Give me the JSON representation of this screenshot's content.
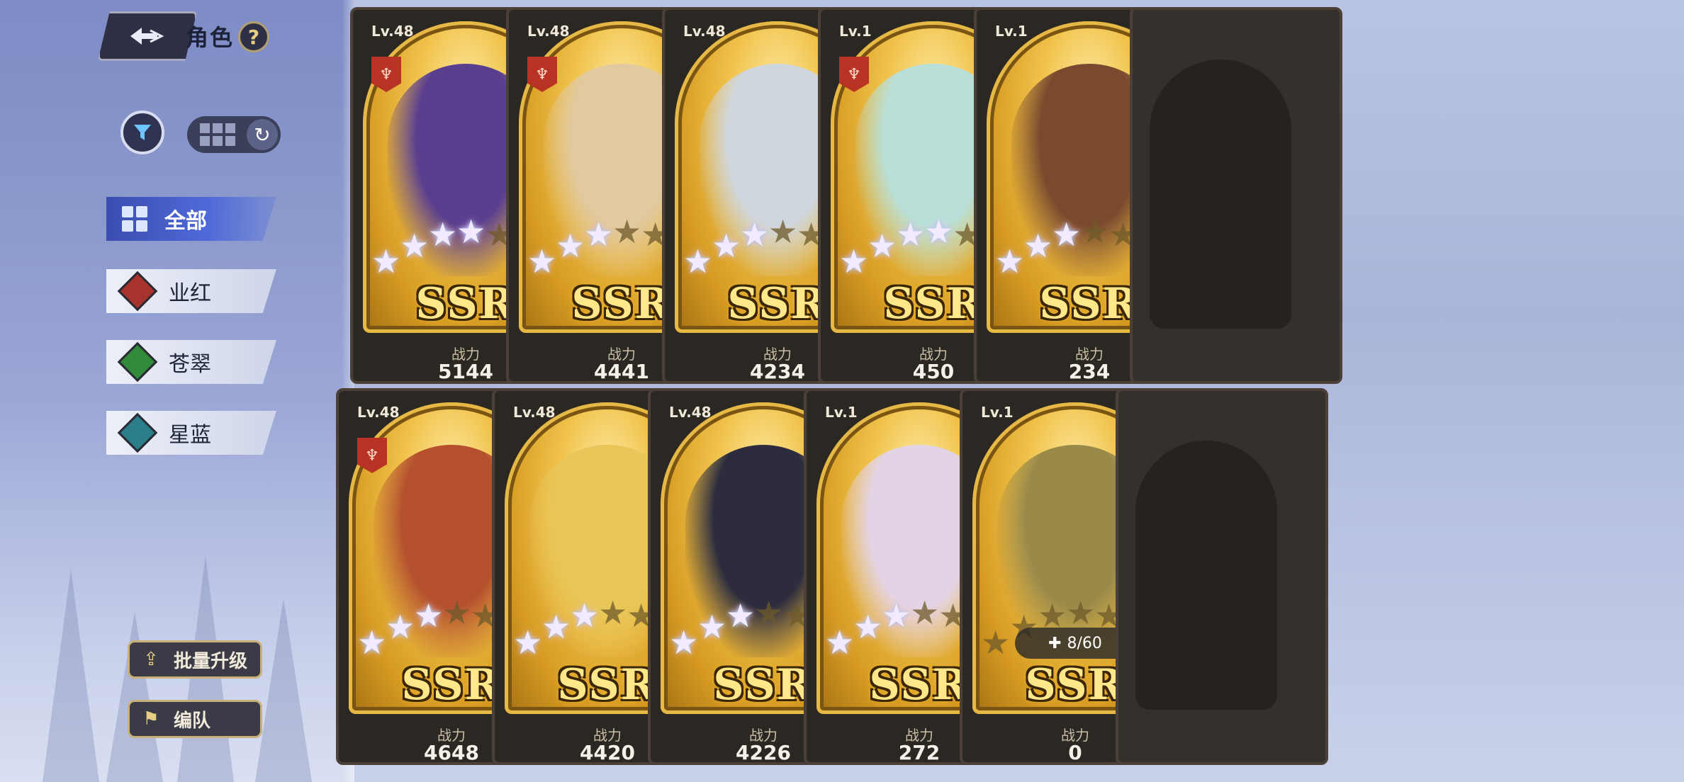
{
  "header": {
    "title": "角色",
    "help_label": "?"
  },
  "filters": [
    {
      "label": "全部",
      "active": true,
      "color": "#4f6ad8"
    },
    {
      "label": "业红",
      "active": false,
      "color": "#a8332c"
    },
    {
      "label": "苍翠",
      "active": false,
      "color": "#2f8a3a"
    },
    {
      "label": "星蓝",
      "active": false,
      "color": "#2b7d8a"
    }
  ],
  "actions": {
    "batch_upgrade": "批量升级",
    "team": "编队"
  },
  "power_label": "战力",
  "cards": [
    {
      "level": "Lv.48",
      "element": "fire",
      "element_color": "#2fa84a",
      "faction": true,
      "rarity": "SSR",
      "stars": 4,
      "power": "5144",
      "tint": "#5b3f8f"
    },
    {
      "level": "Lv.48",
      "element": "sword",
      "element_color": "#d93b3b",
      "faction": true,
      "rarity": "SSR",
      "stars": 3,
      "power": "4441",
      "tint": "#e1c9a0"
    },
    {
      "level": "Lv.48",
      "element": "shield",
      "element_color": "#2fa84a",
      "faction": false,
      "rarity": "SSR",
      "stars": 3,
      "power": "4234",
      "tint": "#cfd6de"
    },
    {
      "level": "Lv.1",
      "element": "sword",
      "element_color": "#d93b3b",
      "faction": true,
      "rarity": "SSR",
      "stars": 4,
      "power": "450",
      "tint": "#b8dfd8"
    },
    {
      "level": "Lv.1",
      "element": "sword",
      "element_color": "#2fa84a",
      "faction": false,
      "rarity": "SSR",
      "stars": 3,
      "power": "234",
      "tint": "#7a4a2e"
    },
    {
      "level": "Lv.48",
      "element": "fire",
      "element_color": "#d93b3b",
      "faction": true,
      "rarity": "SSR",
      "stars": 3,
      "power": "4648",
      "tint": "#b4502e"
    },
    {
      "level": "Lv.48",
      "element": "sword",
      "element_color": "#2e88d8",
      "faction": false,
      "rarity": "SSR",
      "stars": 3,
      "power": "4420",
      "tint": "#e8c65a"
    },
    {
      "level": "Lv.48",
      "element": "sword",
      "element_color": "#2e88d8",
      "faction": false,
      "rarity": "SSR",
      "stars": 3,
      "power": "4226",
      "tint": "#2c2c3e"
    },
    {
      "level": "Lv.1",
      "element": "sword",
      "element_color": "#d93b3b",
      "faction": false,
      "rarity": "SSR",
      "stars": 3,
      "power": "272",
      "tint": "#e3d3e6"
    },
    {
      "level": "Lv.1",
      "element": "fire",
      "element_color": "#2fa84a",
      "faction": false,
      "rarity": "SSR",
      "stars": 0,
      "power": "0",
      "fragments": "8/60",
      "tint": "#9a8a4a"
    }
  ]
}
